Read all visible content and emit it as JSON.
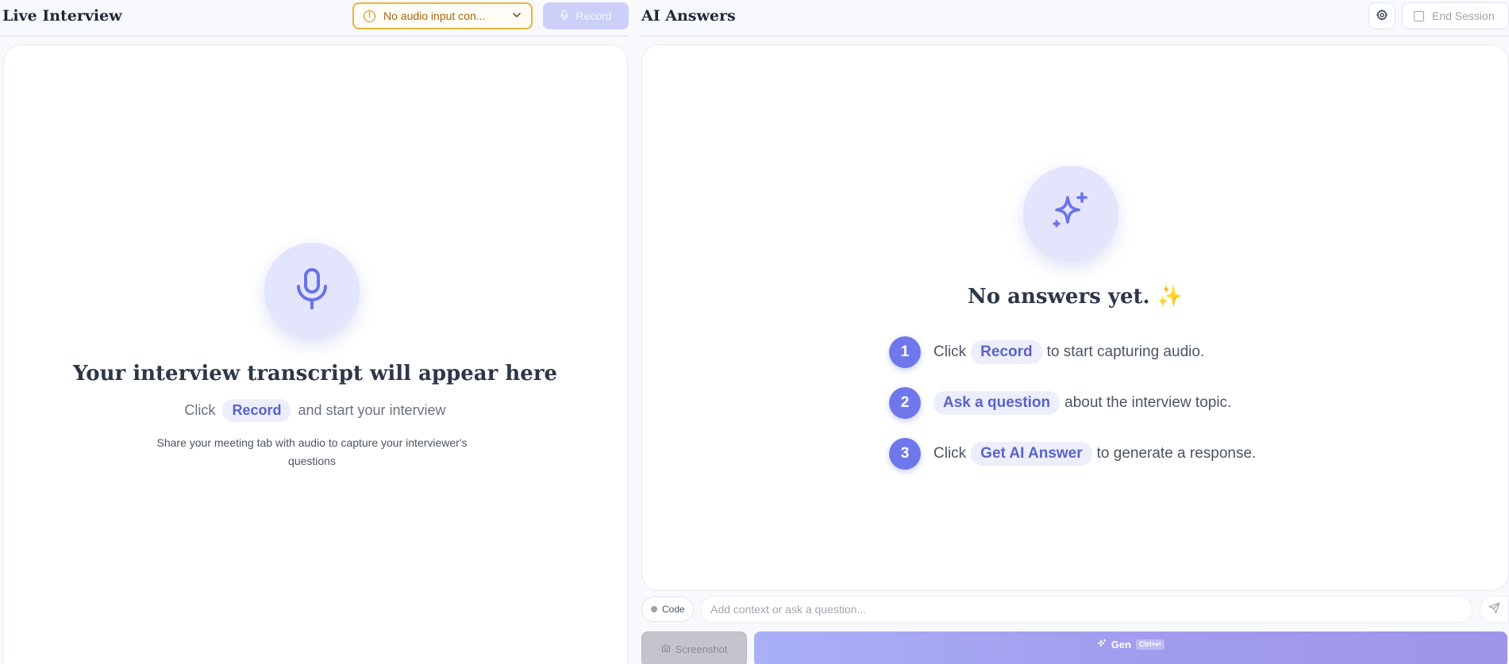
{
  "left_panel": {
    "title": "Live Interview",
    "audio_select": {
      "value": "No audio input con...",
      "icon": "warning-circle-icon"
    },
    "record_button": {
      "label": "Record",
      "icon": "mic-icon"
    },
    "empty_state": {
      "icon": "mic-icon",
      "heading": "Your interview transcript will appear here",
      "click_prefix": "Click",
      "record_pill": "Record",
      "click_suffix": "and start your interview",
      "share_hint": "Share your meeting tab with audio to capture your interviewer's questions"
    }
  },
  "right_panel": {
    "title": "AI Answers",
    "settings_icon": "gear-icon",
    "end_session_label": "End Session",
    "empty_state": {
      "icon": "sparkles-icon",
      "heading": "No answers yet.",
      "heading_emoji": "✨",
      "steps": [
        {
          "num": "1",
          "prefix": "Click",
          "pill": "Record",
          "suffix": "to start capturing audio."
        },
        {
          "num": "2",
          "prefix": "",
          "pill": "Ask a question",
          "suffix": "about the interview topic."
        },
        {
          "num": "3",
          "prefix": "Click",
          "pill": "Get AI Answer",
          "suffix": "to generate a response."
        }
      ]
    },
    "bottom_bar": {
      "code_toggle_label": "Code",
      "input_placeholder": "Add context or ask a question...",
      "input_value": "",
      "send_icon": "send-icon",
      "screenshot_label": "Screenshot",
      "gen_label": "Gen",
      "gen_shortcut": "Ctrl+↵"
    }
  },
  "colors": {
    "accent": "#6f78ea",
    "accent_light": "#e3e5fd",
    "warning_border": "#e8b43c",
    "warning_text": "#a46710",
    "gen_gradient_start": "#a9b0f6",
    "gen_gradient_end": "#9d95e8"
  }
}
